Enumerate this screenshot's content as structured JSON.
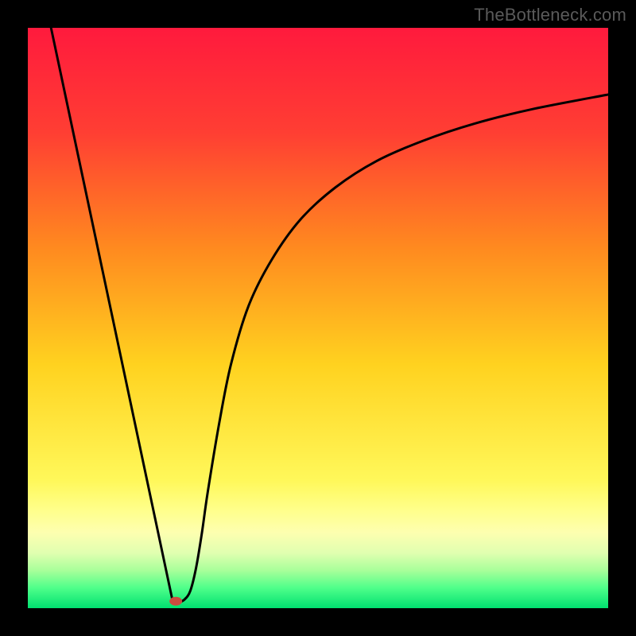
{
  "watermark": "TheBottleneck.com",
  "chart_data": {
    "type": "line",
    "title": "",
    "xlabel": "",
    "ylabel": "",
    "xlim": [
      0,
      100
    ],
    "ylim": [
      0,
      100
    ],
    "gradient_stops": [
      {
        "pos": 0.0,
        "color": "#ff1a3d"
      },
      {
        "pos": 0.18,
        "color": "#ff3e33"
      },
      {
        "pos": 0.38,
        "color": "#ff8a1f"
      },
      {
        "pos": 0.58,
        "color": "#ffd21f"
      },
      {
        "pos": 0.78,
        "color": "#fff85a"
      },
      {
        "pos": 0.83,
        "color": "#ffff8a"
      },
      {
        "pos": 0.87,
        "color": "#fdffb0"
      },
      {
        "pos": 0.905,
        "color": "#e0ffb0"
      },
      {
        "pos": 0.935,
        "color": "#a8ff9a"
      },
      {
        "pos": 0.965,
        "color": "#4fff8a"
      },
      {
        "pos": 1.0,
        "color": "#00e070"
      }
    ],
    "marker": {
      "x": 25.5,
      "y": 1.2,
      "color": "#cc4b3f"
    },
    "series": [
      {
        "name": "left-segment",
        "x": [
          4,
          25
        ],
        "y": [
          100,
          1
        ]
      },
      {
        "name": "dip-and-rise",
        "x": [
          25,
          26,
          27,
          28,
          29,
          30,
          31,
          33,
          35,
          38,
          42,
          47,
          53,
          60,
          68,
          77,
          87,
          100
        ],
        "y": [
          1,
          1,
          1.5,
          3,
          7,
          13,
          20,
          32,
          42,
          52,
          60,
          67,
          72.5,
          77,
          80.5,
          83.5,
          86,
          88.5
        ]
      }
    ]
  }
}
